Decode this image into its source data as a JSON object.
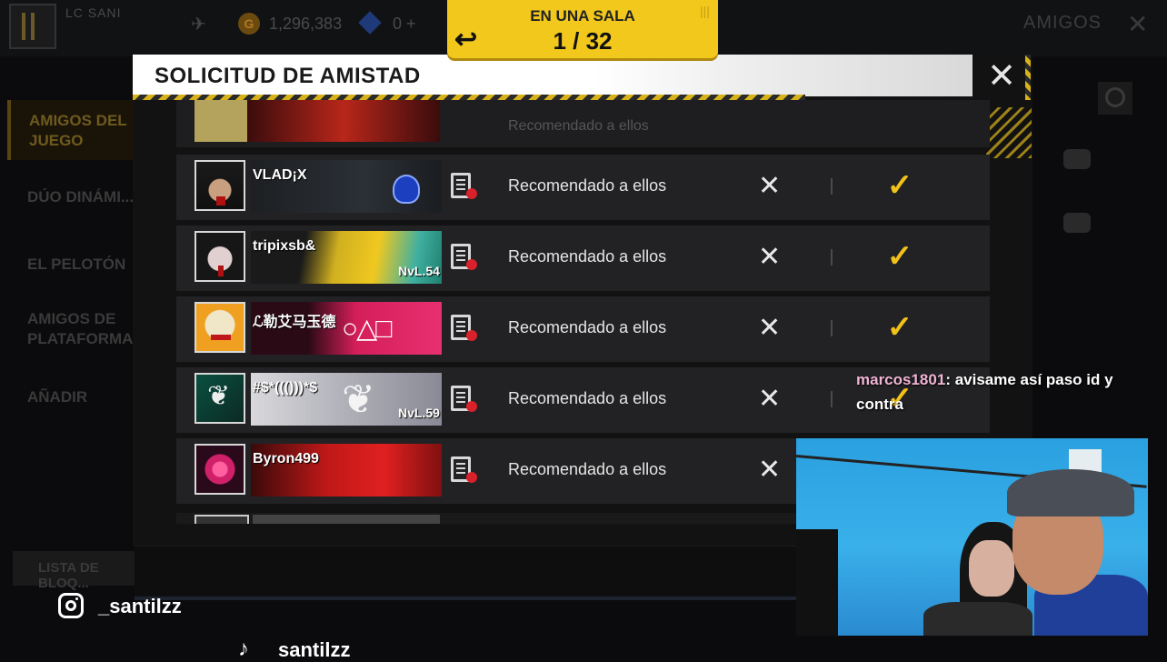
{
  "game": {
    "player_name": "LC SANI",
    "coins": "1,296,383",
    "diamonds": "0 +",
    "amigos_tab": "AMIGOS",
    "sidebar": [
      {
        "label": "AMIGOS DEL\nJUEGO",
        "active": true
      },
      {
        "label": "DÚO DINÁMI..."
      },
      {
        "label": "EL PELOTÓN"
      },
      {
        "label": "AMIGOS DE\nPLATAFORMA"
      },
      {
        "label": "AÑADIR"
      }
    ],
    "block_list": "LISTA DE BLOQ..."
  },
  "room": {
    "title": "EN UNA SALA",
    "count": "1 / 32"
  },
  "dialog": {
    "title": "SOLICITUD DE AMISTAD",
    "partial_top_text": "Recomendado a ellos",
    "requests": [
      {
        "name": "VLAD¡X",
        "level": "",
        "recommend": "Recomendado a ellos",
        "accept_visible": true
      },
      {
        "name": "tripixsb&",
        "level": "NvL.54",
        "recommend": "Recomendado a ellos",
        "accept_visible": true
      },
      {
        "name": "ℒ勒艾马玉德",
        "level": "",
        "recommend": "Recomendado a ellos",
        "accept_visible": true
      },
      {
        "name": "#$*((()))*$",
        "level": "NvL.59",
        "recommend": "Recomendado a ellos",
        "accept_visible": true
      },
      {
        "name": "Byron499",
        "level": "",
        "recommend": "Recomendado a ellos",
        "accept_visible": false
      }
    ]
  },
  "stream": {
    "chat_user": "marcos1801",
    "chat_message": ": avisame así paso id y contra",
    "instagram": "_santilzz",
    "tiktok": "santilzz"
  },
  "colors": {
    "accent_yellow": "#f2c81c",
    "accept_yellow": "#f2c21a",
    "chat_user_pink": "#f0b4d4"
  }
}
